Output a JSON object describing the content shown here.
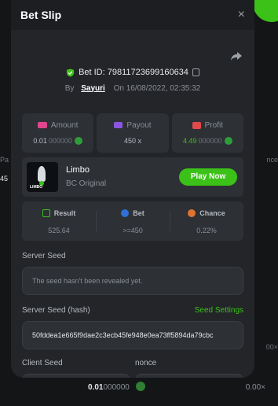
{
  "modal": {
    "title": "Bet Slip",
    "close_glyph": "×",
    "bet_id_label": "Bet ID: 79811723699160634",
    "by_label": "By",
    "username": "Sayuri",
    "on_label": "On",
    "datetime": "16/08/2022, 02:35:32"
  },
  "stats": [
    {
      "label": "Amount",
      "value_main": "0.01",
      "value_dim": "000000",
      "value_color": "#b5bac0",
      "icon": "amount-icon"
    },
    {
      "label": "Payout",
      "value_main": "450 x",
      "value_dim": "",
      "icon": "payout-icon"
    },
    {
      "label": "Profit",
      "value_main": "4.49",
      "value_dim": "000000",
      "value_color": "#3bc117",
      "icon": "profit-icon"
    }
  ],
  "game": {
    "name": "Limbo",
    "subtitle": "BC Original",
    "thumb_brand": "LIMBO",
    "play_label": "Play Now"
  },
  "results": [
    {
      "label": "Result",
      "value": "525.64",
      "icon": "result-icon"
    },
    {
      "label": "Bet",
      "value": ">=450",
      "icon": "bet-icon"
    },
    {
      "label": "Chance",
      "value": "0.22%",
      "icon": "chance-icon"
    }
  ],
  "seeds": {
    "server_seed_label": "Server Seed",
    "server_seed_value": "The seed hasn't been revealed yet.",
    "server_hash_label": "Server Seed (hash)",
    "seed_settings_label": "Seed Settings",
    "server_hash_value": "50fddea1e665f9dae2c3ecb45fe948e0ea73ff5894da79cbc",
    "client_seed_label": "Client Seed",
    "nonce_label": "nonce"
  },
  "background": {
    "left_text_1": "Pa",
    "left_text_2": "45",
    "right_text_1": "nce",
    "right_text_2": "00×",
    "bottom_amount_main": "0.01",
    "bottom_amount_dim": "000000",
    "bottom_right": "0.00×"
  },
  "colors": {
    "accent": "#3bc117",
    "panel": "#232529",
    "card": "#2d3035"
  }
}
